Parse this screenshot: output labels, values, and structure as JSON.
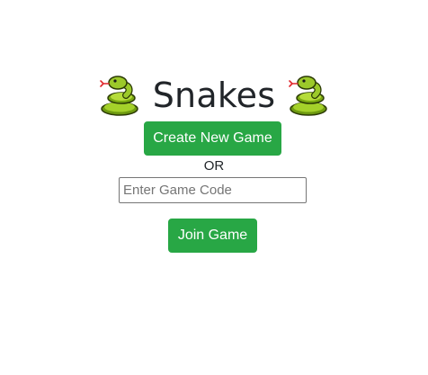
{
  "header": {
    "title": "Snakes",
    "left_icon": "snake-emoji-icon",
    "right_icon": "snake-emoji-icon"
  },
  "actions": {
    "create_label": "Create New Game",
    "or_label": "OR",
    "join_label": "Join Game"
  },
  "game_code": {
    "value": "",
    "placeholder": "Enter Game Code"
  },
  "colors": {
    "button_green": "#28a745",
    "snake_green": "#8fc31f",
    "snake_tongue": "#e0262b"
  }
}
